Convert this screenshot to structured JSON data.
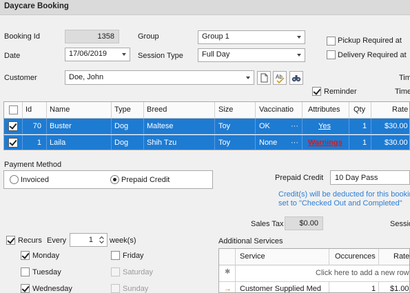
{
  "window": {
    "title": "Daycare Booking"
  },
  "booking": {
    "id_label": "Booking Id",
    "id_value": "1358",
    "group_label": "Group",
    "group_value": "Group 1",
    "pickup_label": "Pickup Required at",
    "delivery_label": "Delivery Required at",
    "date_label": "Date",
    "date_value": "17/06/2019",
    "session_type_label": "Session Type",
    "session_type_value": "Full Day",
    "customer_label": "Customer",
    "customer_value": "Doe, John",
    "time_label_1": "Tim",
    "time_label_2": "Time",
    "reminder_label": "Reminder"
  },
  "pets_grid": {
    "columns": [
      "Id",
      "Name",
      "Type",
      "Breed",
      "Size",
      "Vaccinatio",
      "Attributes",
      "Qty",
      "Rate"
    ],
    "rows": [
      {
        "id": "70",
        "name": "Buster",
        "type": "Dog",
        "breed": "Maltese",
        "size": "Toy",
        "vaccination": "OK",
        "more": "···",
        "attributes": "Yes",
        "qty": "1",
        "rate": "$30.00"
      },
      {
        "id": "1",
        "name": "Laila",
        "type": "Dog",
        "breed": "Shih Tzu",
        "size": "Toy",
        "vaccination": "None",
        "more": "···",
        "attributes": "Warnings",
        "qty": "1",
        "rate": "$30.00"
      }
    ]
  },
  "payment": {
    "label": "Payment Method",
    "invoiced_label": "Invoiced",
    "prepaid_label": "Prepaid Credit",
    "prepaid_credit_label": "Prepaid Credit",
    "prepaid_credit_value": "10 Day Pass",
    "info_line_1": "Credit(s) will be deducted for this bookin",
    "info_line_2": "set to \"Checked Out and Completed\""
  },
  "tax": {
    "label": "Sales Tax",
    "value": "$0.00",
    "session_label": "Sessio"
  },
  "recurs": {
    "label": "Recurs",
    "every_label": "Every",
    "every_value": "1",
    "unit_label": "week(s)",
    "days": {
      "monday": "Monday",
      "tuesday": "Tuesday",
      "wednesday": "Wednesday",
      "friday": "Friday",
      "saturday": "Saturday",
      "sunday": "Sunday"
    }
  },
  "services": {
    "label": "Additional Services",
    "columns": [
      "Service",
      "Occurences",
      "Rate"
    ],
    "new_row_hint": "Click here to add a new row",
    "row": {
      "marker": "→",
      "service": "Customer Supplied Med",
      "occurences": "1",
      "rate": "$1.00"
    },
    "new_row_marker": "✱"
  },
  "icons": [
    "new-document-icon",
    "spell-check-icon",
    "binoculars-icon"
  ],
  "colors": {
    "selection": "#1e7bd2",
    "link_warning": "#d81818",
    "info_text": "#2d7fd4"
  }
}
